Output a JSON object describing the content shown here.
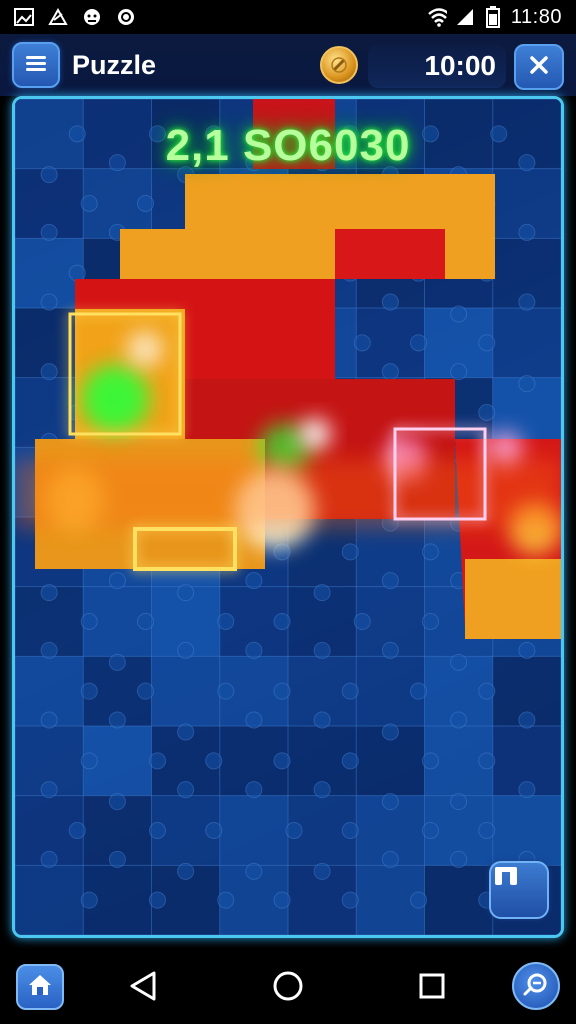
{
  "status_bar": {
    "time": "11:80",
    "left_icons": [
      "image-icon",
      "cast-icon",
      "android-icon",
      "sync-icon"
    ],
    "right_icons": [
      "wifi-icon",
      "signal-icon",
      "battery-icon"
    ]
  },
  "header": {
    "title": "Puzzle",
    "timer": "10:00",
    "coin_icon": "coin-icon",
    "menu_icon": "menu-icon",
    "close_icon": "close-icon"
  },
  "board": {
    "score_text": "2,1 SO6030",
    "pieces_button_label": "Ⅱ"
  },
  "nav_bar": {
    "icons": [
      "home-icon",
      "back-icon",
      "circle-home-icon",
      "recents-icon",
      "zoom-icon"
    ]
  },
  "colors": {
    "board_blue_dark": "#0b2e6e",
    "board_blue_mid": "#1a52a8",
    "piece_orange": "#f0a020",
    "piece_red": "#d41414",
    "glow_green": "#2bff3a",
    "frame_cyan": "#4cc7f0"
  }
}
